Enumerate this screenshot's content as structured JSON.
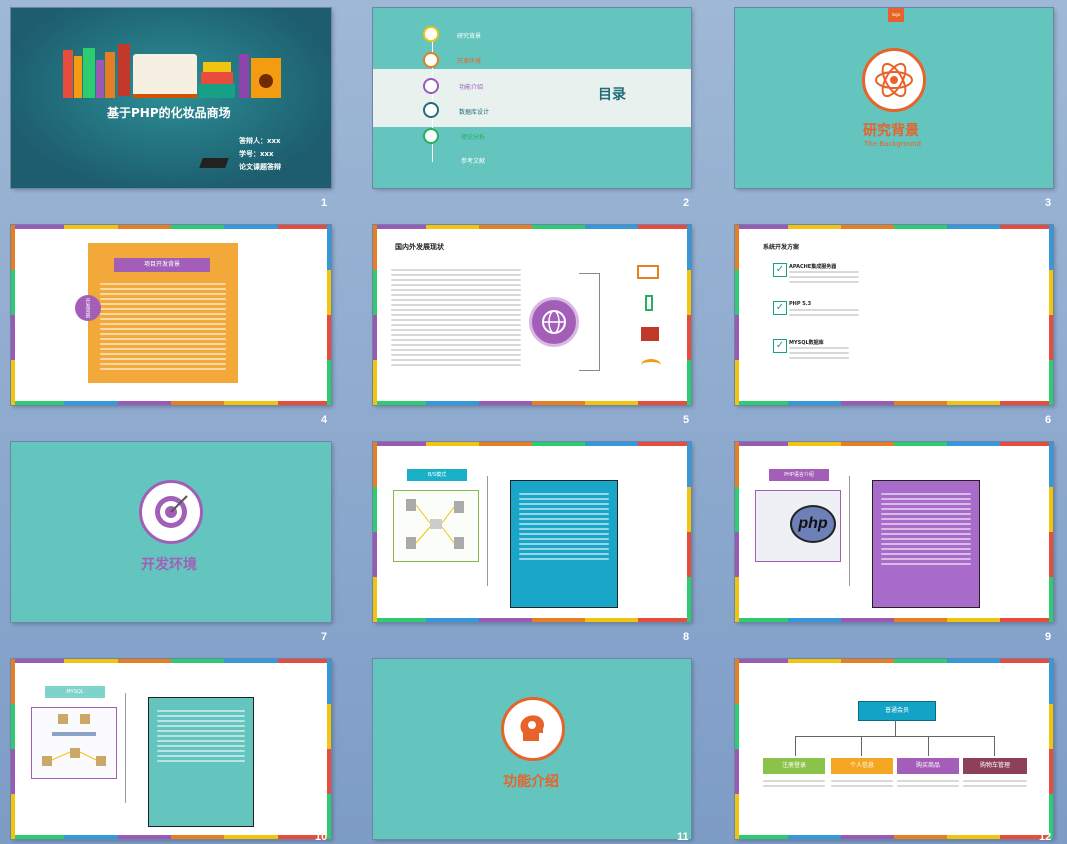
{
  "slides": [
    {
      "num": "1",
      "title": "基于PHP的化妆品商场",
      "answerer": "答辩人：xxx",
      "student_id": "学号：xxx",
      "type_label": "论文课题答辩"
    },
    {
      "num": "2",
      "heading": "目录",
      "menu": [
        "研究背景",
        "开发环境",
        "功能介绍",
        "数据库设计",
        "理论分析",
        "参考文献"
      ]
    },
    {
      "num": "3",
      "logo": "logo",
      "title": "研究背景",
      "subtitle": "The Background"
    },
    {
      "num": "4",
      "box_title": "项目开发背景",
      "side_label": "开发背景"
    },
    {
      "num": "5",
      "title": "国内外发展现状"
    },
    {
      "num": "6",
      "title": "系统开发方案",
      "items": [
        {
          "title": "APACHE集成服务器"
        },
        {
          "title": "PHP 5.3"
        },
        {
          "title": "MYSQL数据库"
        }
      ]
    },
    {
      "num": "7",
      "title": "开发环境"
    },
    {
      "num": "8",
      "tag": "B/S模式"
    },
    {
      "num": "9",
      "tag": "PHP语言介绍",
      "php_logo": "php"
    },
    {
      "num": "10",
      "tag": "MYSQL"
    },
    {
      "num": "11",
      "title": "功能介绍"
    },
    {
      "num": "12",
      "top": "普通会员",
      "branches": [
        "注册登录",
        "个人信息",
        "购买商品",
        "购物车管理"
      ]
    }
  ],
  "colors": {
    "teal": "#63c5bd",
    "orange": "#e8632a",
    "purple": "#a35fb8",
    "dark_teal": "#1f6d7a"
  }
}
